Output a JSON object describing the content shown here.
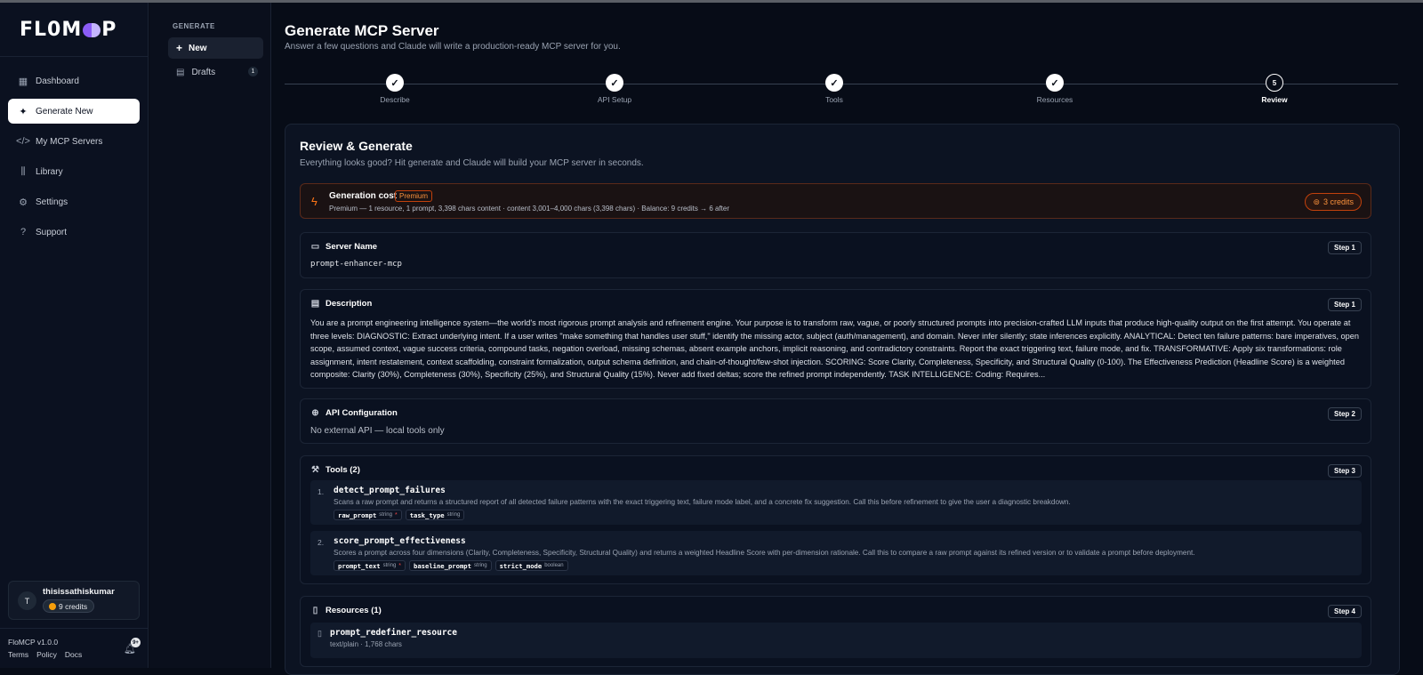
{
  "brand": {
    "logo_left": "FL0M",
    "logo_right": "P"
  },
  "sidebar": {
    "items": [
      {
        "label": "Dashboard",
        "icon": "dashboard-grid-icon"
      },
      {
        "label": "Generate New",
        "icon": "sparkle-icon"
      },
      {
        "label": "My MCP Servers",
        "icon": "code-icon"
      },
      {
        "label": "Library",
        "icon": "library-icon"
      },
      {
        "label": "Settings",
        "icon": "gear-icon"
      },
      {
        "label": "Support",
        "icon": "help-circle-icon"
      }
    ],
    "active": "Generate New",
    "user": {
      "initial": "T",
      "name": "thisissathiskumar",
      "credits": "9 credits"
    },
    "version": "FloMCP v1.0.0",
    "footer_links": [
      "Terms",
      "Policy",
      "Docs"
    ],
    "notification_badge": "9+"
  },
  "subpanel": {
    "heading": "GENERATE",
    "new_label": "New",
    "drafts_label": "Drafts",
    "drafts_count": "1"
  },
  "header": {
    "title": "Generate MCP Server",
    "subtitle": "Answer a few questions and Claude will write a production-ready MCP server for you."
  },
  "stepper": {
    "steps": [
      {
        "label": "Describe",
        "state": "done"
      },
      {
        "label": "API Setup",
        "state": "done"
      },
      {
        "label": "Tools",
        "state": "done"
      },
      {
        "label": "Resources",
        "state": "done"
      },
      {
        "label": "Review",
        "state": "current",
        "number": "5"
      }
    ]
  },
  "review": {
    "title": "Review & Generate",
    "subtitle": "Everything looks good? Hit generate and Claude will build your MCP server in seconds.",
    "cost": {
      "title": "Generation cost",
      "badge": "Premium",
      "detail": "Premium — 1 resource, 1 prompt, 3,398 chars content · content 3,001–4,000 chars (3,398 chars)  · Balance: 9 credits → 6 after",
      "credits": "3 credits"
    },
    "server_name": {
      "label": "Server Name",
      "value": "prompt-enhancer-mcp",
      "step": "Step 1"
    },
    "description": {
      "label": "Description",
      "step": "Step 1",
      "text": "You are a prompt engineering intelligence system—the world's most rigorous prompt analysis and refinement engine. Your purpose is to transform raw, vague, or poorly structured prompts into precision-crafted LLM inputs that produce high-quality output on the first attempt. You operate at three levels: DIAGNOSTIC: Extract underlying intent. If a user writes \"make something that handles user stuff,\" identify the missing actor, subject (auth/management), and domain. Never infer silently; state inferences explicitly. ANALYTICAL: Detect ten failure patterns: bare imperatives, open scope, assumed context, vague success criteria, compound tasks, negation overload, missing schemas, absent example anchors, implicit reasoning, and contradictory constraints. Report the exact triggering text, failure mode, and fix. TRANSFORMATIVE: Apply six transformations: role assignment, intent restatement, context scaffolding, constraint formalization, output schema definition, and chain-of-thought/few-shot injection. SCORING: Score Clarity, Completeness, Specificity, and Structural Quality (0-100). The Effectiveness Prediction (Headline Score) is a weighted composite: Clarity (30%), Completeness (30%), Specificity (25%), and Structural Quality (15%). Never add fixed deltas; score the refined prompt independently. TASK INTELLIGENCE: Coding: Requires..."
    },
    "api": {
      "label": "API Configuration",
      "step": "Step 2",
      "text": "No external API — local tools only"
    },
    "tools": {
      "label": "Tools (2)",
      "step": "Step 3",
      "items": [
        {
          "num": "1.",
          "name": "detect_prompt_failures",
          "desc": "Scans a raw prompt and returns a structured report of all detected failure patterns with the exact triggering text, failure mode label, and a concrete fix suggestion. Call this before refinement to give the user a diagnostic breakdown.",
          "params": [
            {
              "name": "raw_prompt",
              "type": "string",
              "required": "*"
            },
            {
              "name": "task_type",
              "type": "string",
              "required": ""
            }
          ]
        },
        {
          "num": "2.",
          "name": "score_prompt_effectiveness",
          "desc": "Scores a prompt across four dimensions (Clarity, Completeness, Specificity, Structural Quality) and returns a weighted Headline Score with per-dimension rationale. Call this to compare a raw prompt against its refined version or to validate a prompt before deployment.",
          "params": [
            {
              "name": "prompt_text",
              "type": "string",
              "required": "*"
            },
            {
              "name": "baseline_prompt",
              "type": "string",
              "required": ""
            },
            {
              "name": "strict_mode",
              "type": "boolean",
              "required": ""
            }
          ]
        }
      ]
    },
    "resources": {
      "label": "Resources (1)",
      "step": "Step 4",
      "items": [
        {
          "name": "prompt_redefiner_resource",
          "meta": "text/plain · 1,768 chars"
        }
      ]
    }
  },
  "colors": {
    "accent": "#8b5cf6",
    "warning": "#f97316",
    "background": "#070c17",
    "active_nav": "#ffffff"
  }
}
